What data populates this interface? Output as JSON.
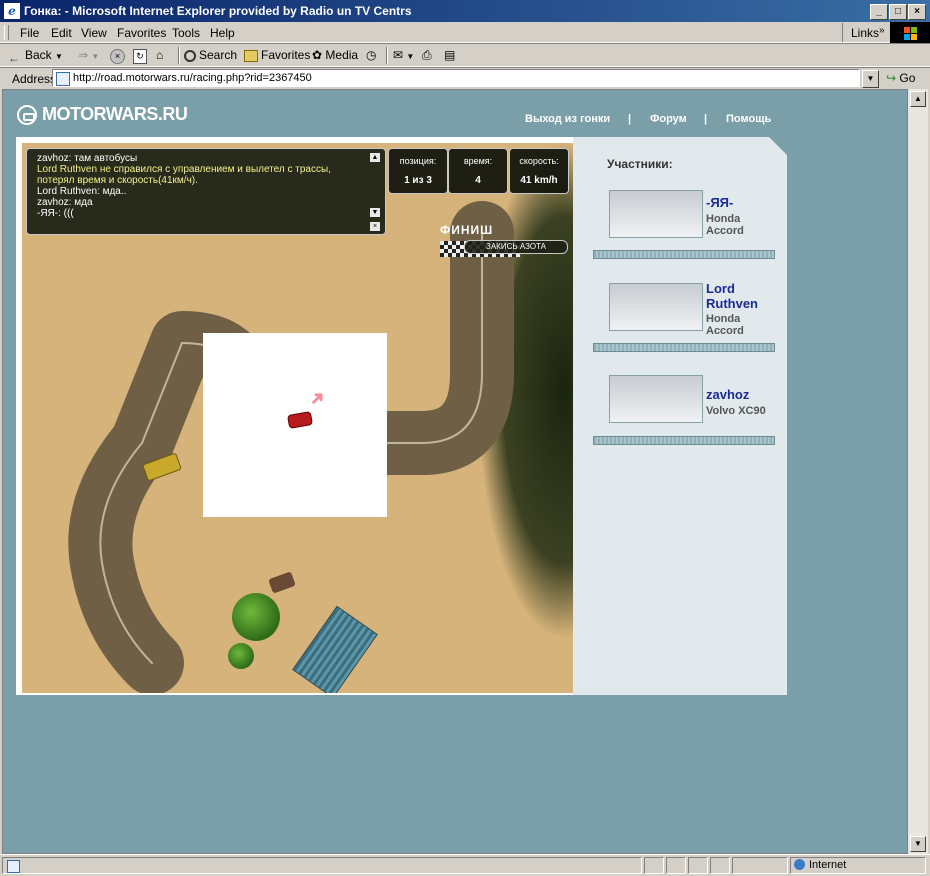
{
  "window": {
    "title": "Гонка: - Microsoft Internet Explorer provided by Radio un TV Centrs"
  },
  "menu": [
    "File",
    "Edit",
    "View",
    "Favorites",
    "Tools",
    "Help"
  ],
  "links_label": "Links",
  "toolbar": {
    "back": "Back",
    "search": "Search",
    "favorites": "Favorites",
    "media": "Media"
  },
  "address": {
    "label": "Address",
    "url": "http://road.motorwars.ru/racing.php?rid=2367450",
    "go": "Go"
  },
  "status": {
    "zone": "Internet"
  },
  "site": {
    "logo": "MOTORWARS.RU",
    "nav": [
      "Выход из гонки",
      "|",
      "Форум",
      "|",
      "Помощь"
    ]
  },
  "chat": {
    "lines": [
      {
        "text": "zavhoz: там автобусы",
        "color": "#ffffff"
      },
      {
        "text": "Lord Ruthven не справился с управлением и вылетел с трассы,",
        "color": "#f4f08a"
      },
      {
        "text": "потерял время и скорость(41км/ч).",
        "color": "#f4f08a"
      },
      {
        "text": "Lord Ruthven: мда..",
        "color": "#ffffff"
      },
      {
        "text": "zavhoz: мда",
        "color": "#ffffff"
      },
      {
        "text": "-ЯЯ-: (((",
        "color": "#ffffff"
      }
    ]
  },
  "hud": {
    "position_label": "позиция:",
    "position_value": "1 из 3",
    "time_label": "время:",
    "time_value": "4",
    "speed_label": "скорость:",
    "speed_value": "41 km/h"
  },
  "finish_label": "ФИНИШ",
  "nitro_label": "ЗАКИСЬ АЗОТА",
  "participants": {
    "header": "Участники:",
    "list": [
      {
        "name": "-ЯЯ-",
        "model_line1": "Honda",
        "model_line2": "Accord"
      },
      {
        "name_line1": "Lord",
        "name_line2": "Ruthven",
        "model_line1": "Honda",
        "model_line2": "Accord"
      },
      {
        "name": "zavhoz",
        "model_line1": "Volvo XC90"
      }
    ]
  }
}
